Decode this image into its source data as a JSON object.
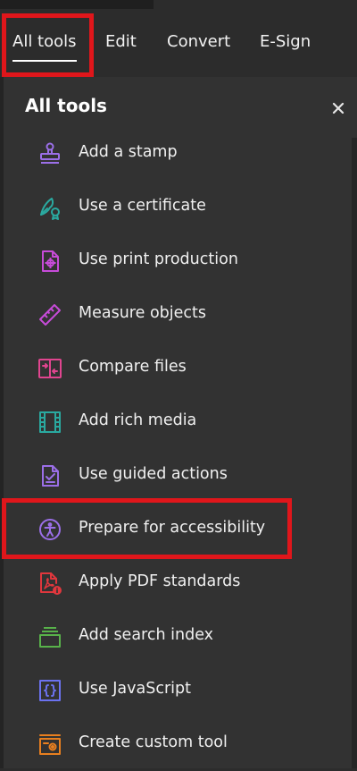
{
  "tabs": [
    {
      "label": "All tools",
      "active": true
    },
    {
      "label": "Edit"
    },
    {
      "label": "Convert"
    },
    {
      "label": "E-Sign"
    }
  ],
  "panel": {
    "title": "All tools",
    "close_label": "×",
    "tools": [
      {
        "label": "Add a stamp",
        "icon": "stamp-icon",
        "color": "#9b6fe8"
      },
      {
        "label": "Use a certificate",
        "icon": "certificate-icon",
        "color": "#2aa9a0"
      },
      {
        "label": "Use print production",
        "icon": "print-production-icon",
        "color": "#c64bd8"
      },
      {
        "label": "Measure objects",
        "icon": "ruler-icon",
        "color": "#c64bd8"
      },
      {
        "label": "Compare files",
        "icon": "compare-files-icon",
        "color": "#e0458f"
      },
      {
        "label": "Add rich media",
        "icon": "film-icon",
        "color": "#2aa9a0"
      },
      {
        "label": "Use guided actions",
        "icon": "guided-actions-icon",
        "color": "#9b6fe8"
      },
      {
        "label": "Prepare for accessibility",
        "icon": "accessibility-icon",
        "color": "#9b6fe8"
      },
      {
        "label": "Apply PDF standards",
        "icon": "pdf-standards-icon",
        "color": "#e0373d"
      },
      {
        "label": "Add search index",
        "icon": "search-index-icon",
        "color": "#58b24a"
      },
      {
        "label": "Use JavaScript",
        "icon": "javascript-icon",
        "color": "#6b72f0"
      },
      {
        "label": "Create custom tool",
        "icon": "custom-tool-icon",
        "color": "#e87f1f"
      }
    ]
  },
  "colors": {
    "highlight": "#e0161b"
  }
}
